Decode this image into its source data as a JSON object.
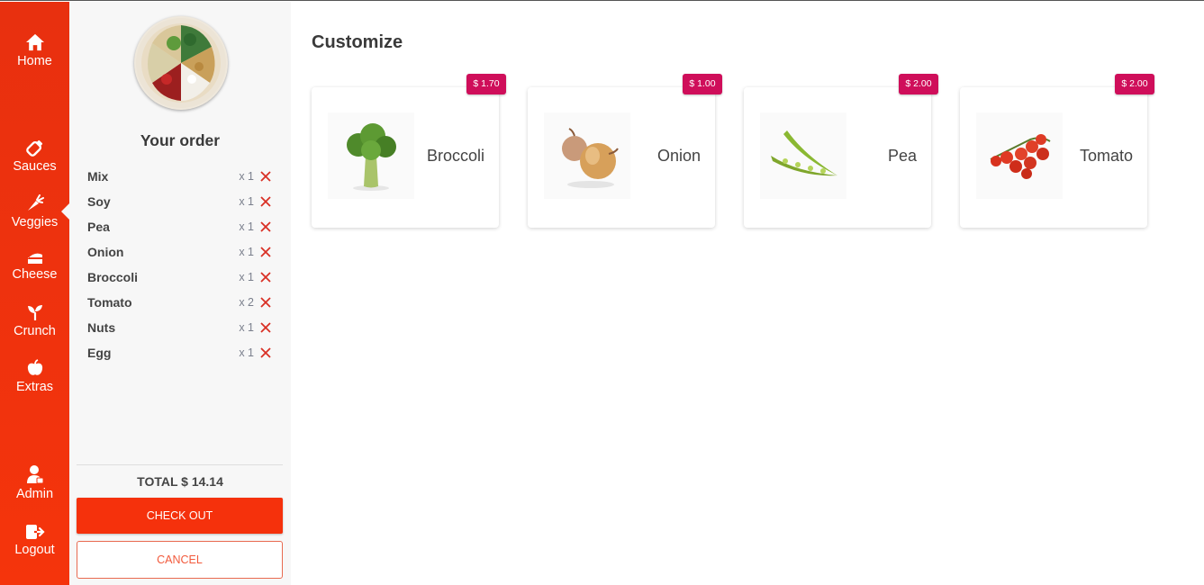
{
  "nav": {
    "items": [
      {
        "label": "Home",
        "icon": "home-icon"
      },
      {
        "label": "Sauces",
        "icon": "sauce-bottle-icon"
      },
      {
        "label": "Veggies",
        "icon": "carrot-icon"
      },
      {
        "label": "Cheese",
        "icon": "cheese-icon"
      },
      {
        "label": "Crunch",
        "icon": "sprout-icon"
      },
      {
        "label": "Extras",
        "icon": "apple-icon"
      },
      {
        "label": "Admin",
        "icon": "admin-user-icon"
      },
      {
        "label": "Logout",
        "icon": "logout-icon"
      }
    ],
    "active": "Veggies",
    "color": "#f5310c"
  },
  "order": {
    "title": "Your order",
    "items": [
      {
        "name": "Mix",
        "qty": "x 1"
      },
      {
        "name": "Soy",
        "qty": "x 1"
      },
      {
        "name": "Pea",
        "qty": "x 1"
      },
      {
        "name": "Onion",
        "qty": "x 1"
      },
      {
        "name": "Broccoli",
        "qty": "x 1"
      },
      {
        "name": "Tomato",
        "qty": "x 2"
      },
      {
        "name": "Nuts",
        "qty": "x 1"
      },
      {
        "name": "Egg",
        "qty": "x 1"
      }
    ],
    "total": "TOTAL $ 14.14",
    "checkout_label": "CHECK OUT",
    "cancel_label": "CANCEL"
  },
  "main": {
    "title": "Customize",
    "products": [
      {
        "name": "Broccoli",
        "price": "$ 1.70"
      },
      {
        "name": "Onion",
        "price": "$ 1.00"
      },
      {
        "name": "Pea",
        "price": "$ 2.00"
      },
      {
        "name": "Tomato",
        "price": "$ 2.00"
      }
    ],
    "price_color": "#cf0e5a"
  }
}
